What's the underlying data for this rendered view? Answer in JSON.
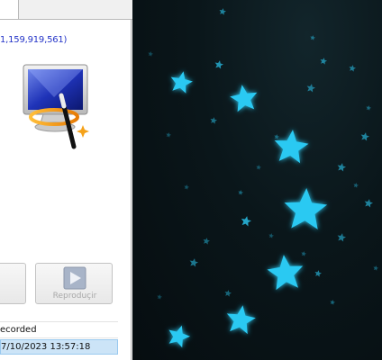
{
  "dialog": {
    "space_info": "1,159,919,561)",
    "play_button_label": "Reproduçir",
    "list": {
      "header": "ecorded",
      "rows": [
        {
          "date": "7/10/2023 13:57:18"
        }
      ]
    }
  },
  "icons": {
    "restore": "system-restore-monitor-wand-icon",
    "play": "play-icon",
    "wallpaper": "glowing-stars-wallpaper"
  },
  "colors": {
    "space_text": "#2434c8",
    "selected_row": "#cce4f7",
    "star_glow": "#2bc9f2",
    "desktop_bg": "#0a161a"
  }
}
